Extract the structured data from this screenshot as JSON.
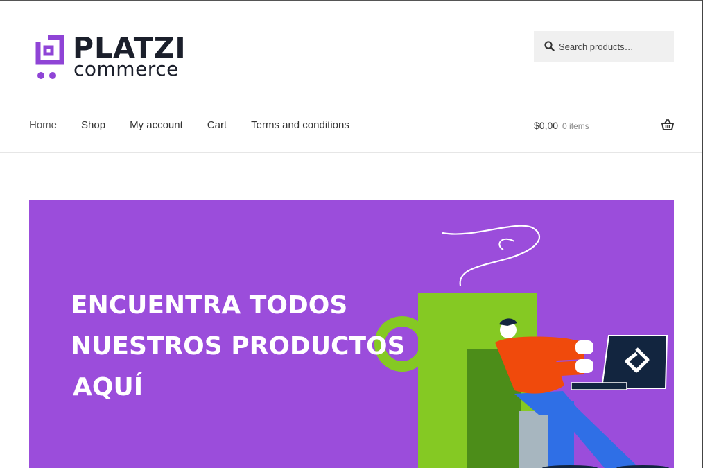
{
  "header": {
    "logo": {
      "word1": "PLATZI",
      "word2": "commerce"
    },
    "search": {
      "placeholder": "Search products…"
    },
    "nav": [
      {
        "label": "Home"
      },
      {
        "label": "Shop"
      },
      {
        "label": "My account"
      },
      {
        "label": "Cart"
      },
      {
        "label": "Terms and conditions"
      }
    ],
    "cart": {
      "amount": "$0,00",
      "count": "0 items"
    }
  },
  "hero": {
    "lines": [
      "ENCUENTRA TODOS",
      "NUESTROS PRODUCTOS",
      "AQUÍ"
    ]
  },
  "colors": {
    "brand_purple": "#9b4ddb",
    "logo_purple": "#8f44d6",
    "mug_green": "#85c923",
    "shirt_orange": "#f04a0c",
    "pants_blue": "#2f6fe6",
    "laptop_navy": "#12253f"
  },
  "icons": [
    "search-icon",
    "basket-icon",
    "platzi-logo-icon"
  ]
}
